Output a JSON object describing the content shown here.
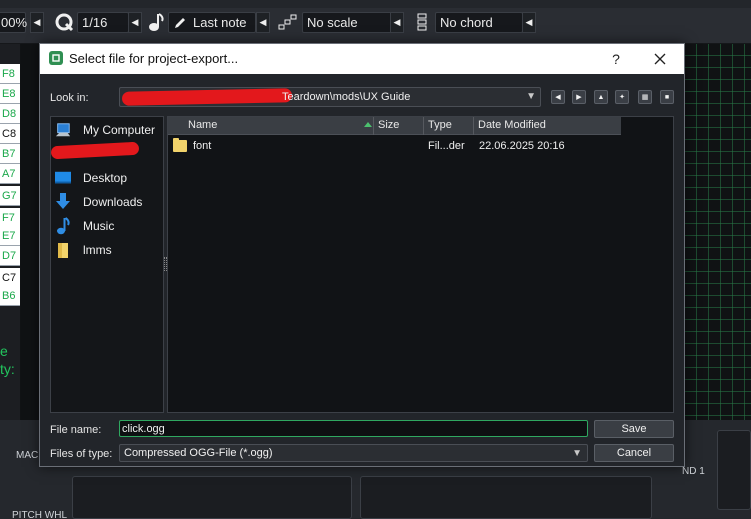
{
  "toolbar": {
    "zoom": "00%",
    "quantize": "1/16",
    "note_length": "Last note",
    "scale": "No scale",
    "chord": "No chord"
  },
  "piano": {
    "keys": [
      "F8",
      "E8",
      "D8",
      "C8",
      "B7",
      "A7",
      "G7",
      "F7",
      "E7",
      "D7",
      "C7",
      "B6"
    ]
  },
  "background": {
    "side_text_1": "e",
    "side_text_2": "ty:",
    "macro_label": "MACI",
    "pitch_label": "PITCH WHL",
    "end_label": "ND 1"
  },
  "dialog": {
    "title": "Select file for project-export...",
    "help_label": "?",
    "look_in_label": "Look in:",
    "look_in_path": "Teardown\\mods\\UX Guide",
    "sidebar": {
      "items": [
        {
          "label": "My Computer",
          "icon": "computer-icon"
        },
        {
          "label": "Desktop",
          "icon": "desktop-icon"
        },
        {
          "label": "Downloads",
          "icon": "downloads-icon"
        },
        {
          "label": "Music",
          "icon": "music-icon"
        },
        {
          "label": "lmms",
          "icon": "folder-icon"
        }
      ]
    },
    "columns": {
      "name": "Name",
      "size": "Size",
      "type": "Type",
      "date": "Date Modified"
    },
    "files": [
      {
        "name": "font",
        "size": "",
        "type": "Fil...der",
        "date": "22.06.2025 20:16"
      }
    ],
    "file_name_label": "File name:",
    "file_name_value": "click.ogg",
    "file_type_label": "Files of type:",
    "file_type_value": "Compressed OGG-File (*.ogg)",
    "save_label": "Save",
    "cancel_label": "Cancel"
  },
  "colors": {
    "accent": "#2fa860",
    "redaction": "#e3181c"
  }
}
